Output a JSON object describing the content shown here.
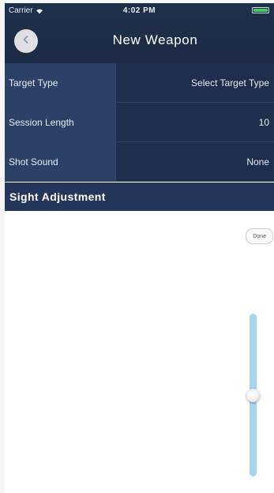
{
  "status_bar": {
    "carrier": "Carrier",
    "time": "4:02 PM",
    "battery_level": 1.0,
    "battery_color": "#3ecf5a"
  },
  "nav": {
    "title": "New Weapon",
    "back_icon": "chevron-left-icon"
  },
  "rows": [
    {
      "label": "Target Type",
      "value": "Select Target Type"
    },
    {
      "label": "Session Length",
      "value": "10"
    },
    {
      "label": "Shot Sound",
      "value": "None"
    }
  ],
  "section": {
    "title": "Sight Adjustment"
  },
  "sight_adjustment": {
    "done_label": "Done",
    "slider_value": 0.5
  },
  "colors": {
    "nav_background": "#1e2f4a",
    "row_label_background": "#2b4266",
    "slider_track": "#a9d4ee"
  }
}
